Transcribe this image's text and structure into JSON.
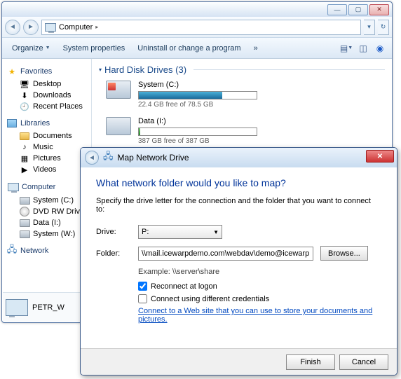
{
  "explorer": {
    "address": "Computer",
    "address_sep": "▸",
    "toolbar": {
      "organize": "Organize",
      "sysprops": "System properties",
      "uninstall": "Uninstall or change a program",
      "more": "»"
    },
    "sidebar": {
      "favorites": "Favorites",
      "fav_items": [
        "Desktop",
        "Downloads",
        "Recent Places"
      ],
      "libraries": "Libraries",
      "lib_items": [
        "Documents",
        "Music",
        "Pictures",
        "Videos"
      ],
      "computer": "Computer",
      "comp_items": [
        "System (C:)",
        "DVD RW Drive",
        "Data (I:)",
        "System (W:)"
      ],
      "network": "Network"
    },
    "content": {
      "section": "Hard Disk Drives (3)",
      "drives": [
        {
          "name": "System (C:)",
          "free": "22.4 GB free of 78.5 GB",
          "pct": 71
        },
        {
          "name": "Data (I:)",
          "free": "387 GB free of 387 GB",
          "pct": 1
        }
      ]
    },
    "details_name": "PETR_W"
  },
  "dialog": {
    "title": "Map Network Drive",
    "heading": "What network folder would you like to map?",
    "desc": "Specify the drive letter for the connection and the folder that you want to connect to:",
    "drive_label": "Drive:",
    "drive_value": "P:",
    "folder_label": "Folder:",
    "folder_value": "\\\\mail.icewarpdemo.com\\webdav\\demo@icewarp",
    "browse": "Browse...",
    "example": "Example: \\\\server\\share",
    "reconnect": "Reconnect at logon",
    "diffcreds": "Connect using different credentials",
    "link": "Connect to a Web site that you can use to store your documents and pictures.",
    "finish": "Finish",
    "cancel": "Cancel"
  }
}
